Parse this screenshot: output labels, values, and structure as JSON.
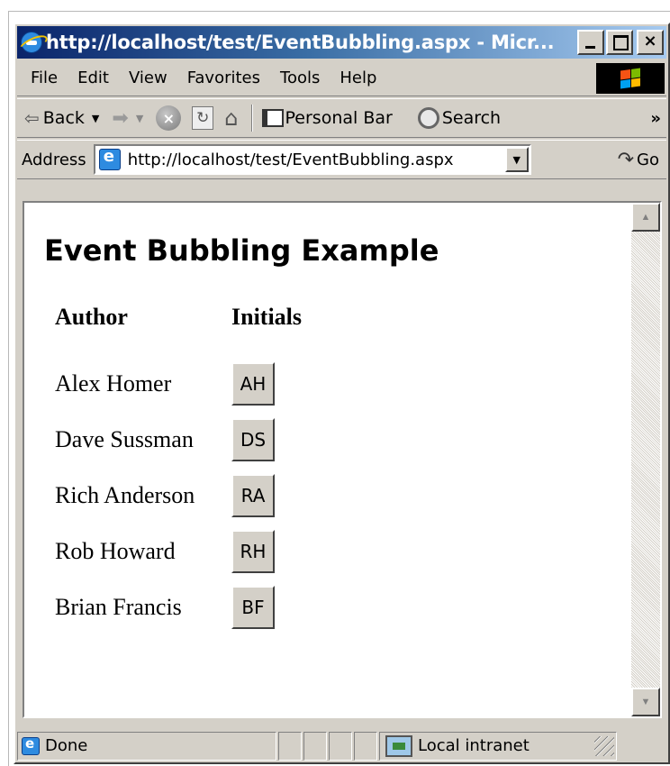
{
  "window": {
    "title": "http://localhost/test/EventBubbling.aspx - Micr...",
    "controls": {
      "minimize": "minimize-icon",
      "maximize": "maximize-icon",
      "close": "×"
    }
  },
  "menu": [
    "File",
    "Edit",
    "View",
    "Favorites",
    "Tools",
    "Help"
  ],
  "toolbar": {
    "back": "Back",
    "personal_bar": "Personal Bar",
    "search": "Search",
    "more": "»"
  },
  "address": {
    "label": "Address",
    "url": "http://localhost/test/EventBubbling.aspx",
    "go": "Go"
  },
  "page": {
    "heading": "Event Bubbling Example",
    "columns": [
      "Author",
      "Initials"
    ],
    "rows": [
      {
        "author": "Alex Homer",
        "initials": "AH"
      },
      {
        "author": "Dave Sussman",
        "initials": "DS"
      },
      {
        "author": "Rich Anderson",
        "initials": "RA"
      },
      {
        "author": "Rob Howard",
        "initials": "RH"
      },
      {
        "author": "Brian Francis",
        "initials": "BF"
      }
    ]
  },
  "status": {
    "text": "Done",
    "zone": "Local intranet"
  },
  "colors": {
    "title_gradient_start": "#0a246a",
    "title_gradient_end": "#a6caf0",
    "chrome": "#d4d0c8"
  }
}
